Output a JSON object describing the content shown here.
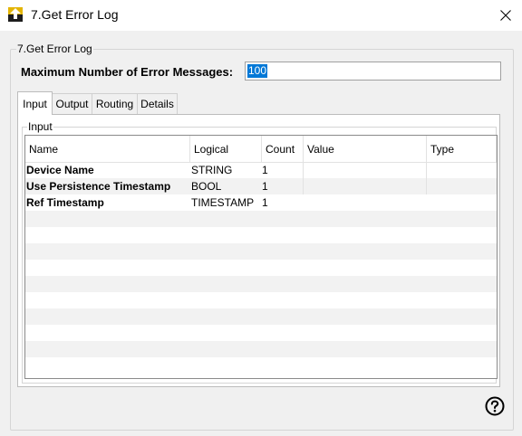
{
  "window": {
    "title": "7.Get Error Log",
    "icon": "up-arrow-app-icon"
  },
  "group": {
    "legend": "7.Get Error Log"
  },
  "max_messages": {
    "label": "Maximum Number of Error Messages:",
    "value": "100"
  },
  "tabs": [
    {
      "label": "Input",
      "active": true
    },
    {
      "label": "Output",
      "active": false
    },
    {
      "label": "Routing",
      "active": false
    },
    {
      "label": "Details",
      "active": false
    }
  ],
  "input_group": {
    "legend": "Input"
  },
  "table": {
    "columns": [
      "Name",
      "Logical",
      "Count",
      "Value",
      "Type"
    ],
    "rows": [
      {
        "name": "Device Name",
        "logical": "STRING",
        "count": "1",
        "value": "",
        "type": ""
      },
      {
        "name": "Use Persistence Timestamp",
        "logical": "BOOL",
        "count": "1",
        "value": "",
        "type": ""
      },
      {
        "name": "Ref Timestamp",
        "logical": "TIMESTAMP",
        "count": "1",
        "value": "",
        "type": ""
      }
    ]
  }
}
